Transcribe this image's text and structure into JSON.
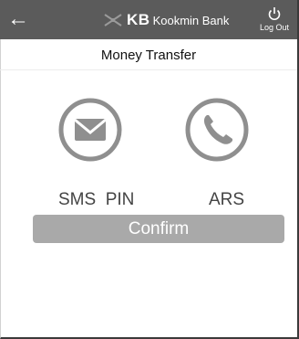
{
  "header": {
    "back_symbol": "←",
    "brand_short": "KB",
    "brand_name": "Kookmin Bank",
    "logout_label": "Log Out"
  },
  "page": {
    "title": "Money Transfer"
  },
  "options": {
    "sms": {
      "label": "SMS  PIN",
      "icon": "envelope-icon"
    },
    "ars": {
      "label": "ARS",
      "icon": "phone-icon"
    }
  },
  "confirm_label": "Confirm",
  "colors": {
    "header_bg": "#5b5b5b",
    "icon_gray": "#8f8f8f",
    "button_bg": "#a9a9a9"
  }
}
